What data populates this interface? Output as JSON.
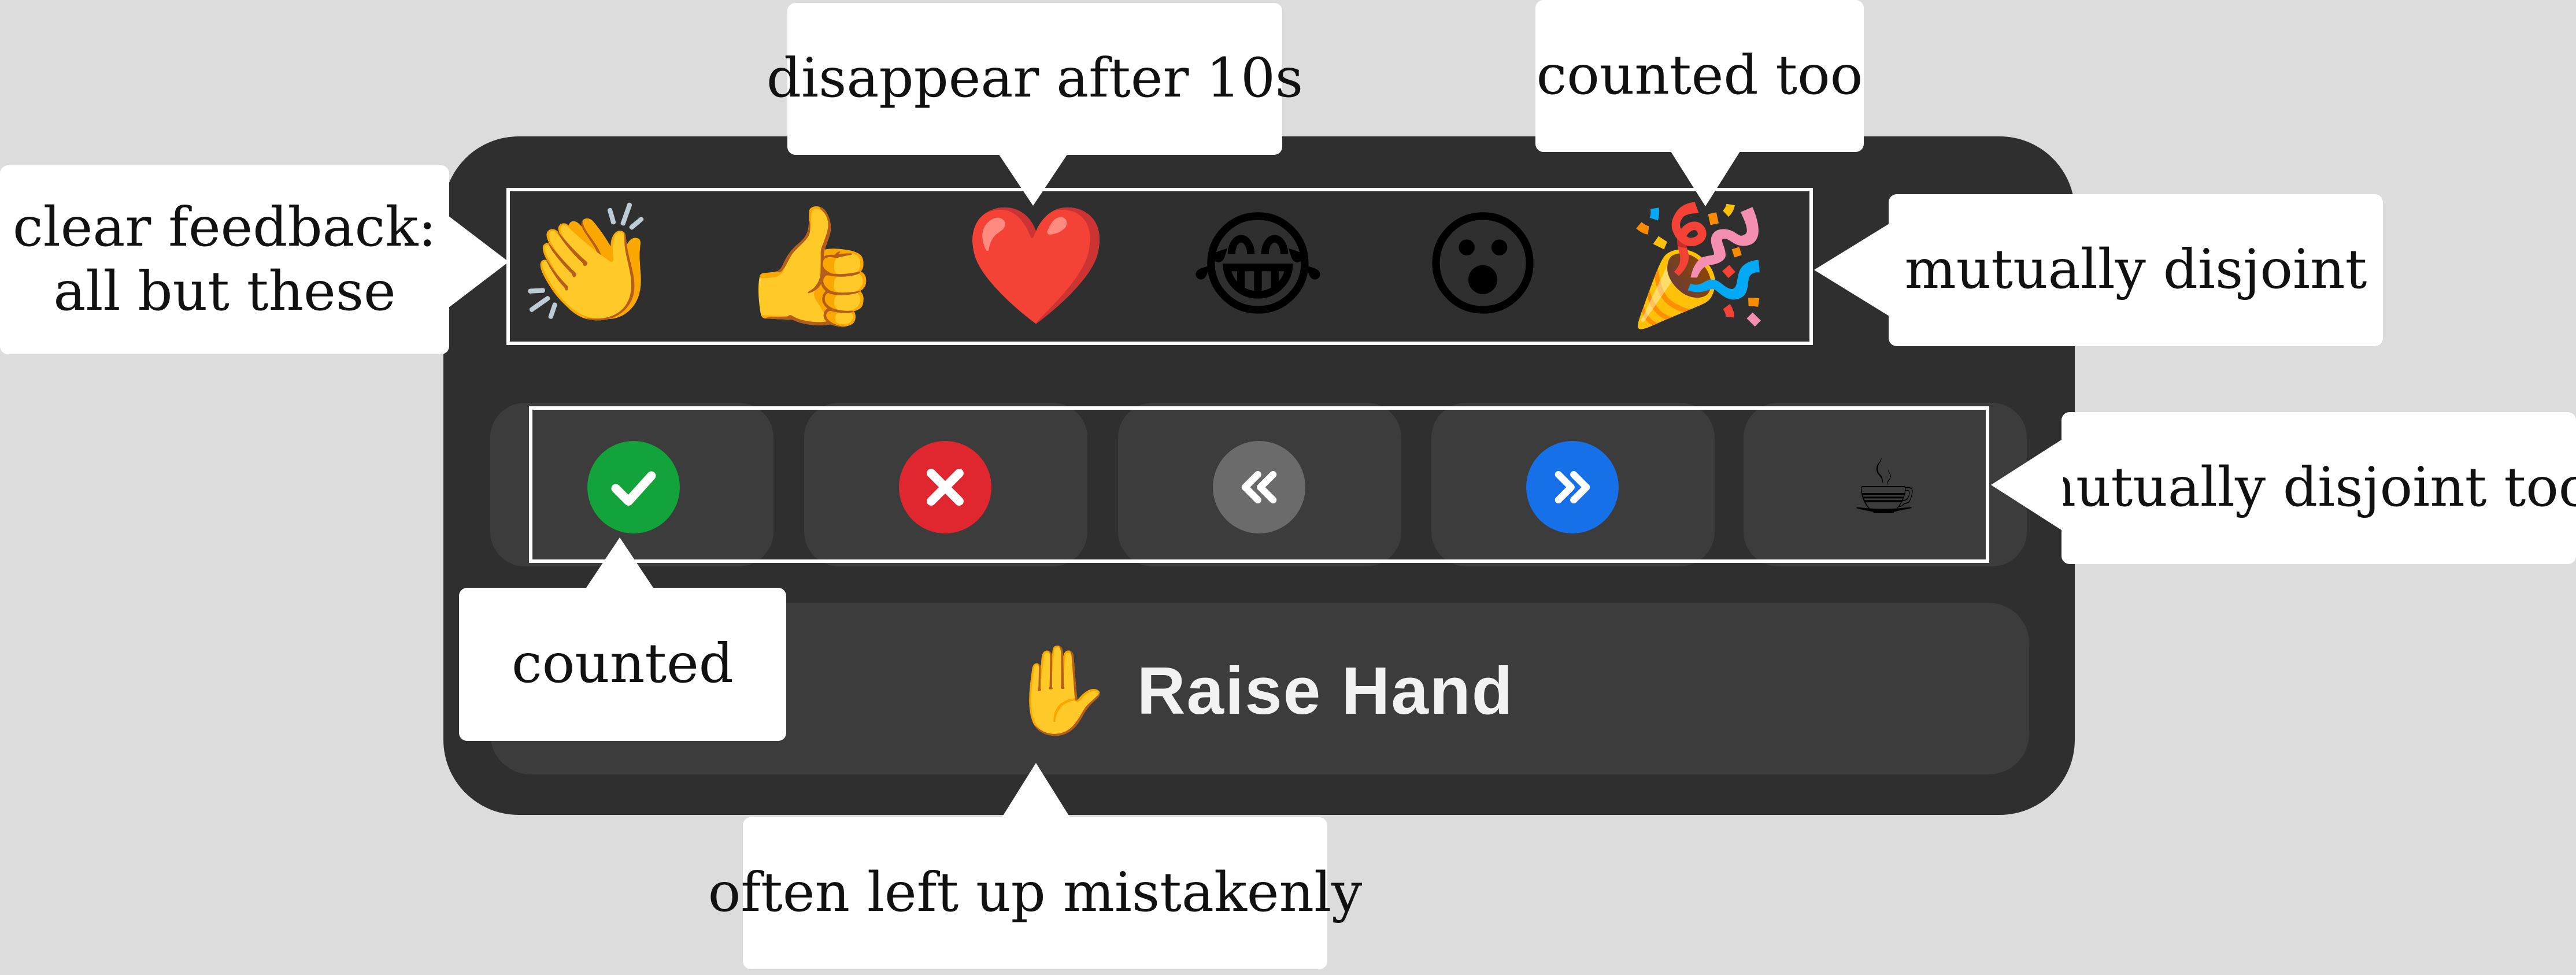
{
  "reactions": [
    {
      "name": "clapping-hands",
      "glyph": "👏"
    },
    {
      "name": "thumbs-up",
      "glyph": "👍"
    },
    {
      "name": "heart",
      "glyph": "❤️"
    },
    {
      "name": "tears-of-joy",
      "glyph": "😂"
    },
    {
      "name": "surprised-face",
      "glyph": "😮"
    },
    {
      "name": "party-popper",
      "glyph": "🎉"
    }
  ],
  "status_buttons": [
    {
      "name": "yes",
      "icon": "checkmark-icon",
      "color": "#12a33a"
    },
    {
      "name": "no",
      "icon": "x-icon",
      "color": "#e0262e"
    },
    {
      "name": "go-slower",
      "icon": "rewind-icon",
      "color": "#6b6b6b"
    },
    {
      "name": "go-faster",
      "icon": "fast-forward-icon",
      "color": "#1670e8"
    },
    {
      "name": "coffee-break",
      "glyph": "☕"
    }
  ],
  "raise_hand": {
    "glyph": "✋",
    "label": "Raise Hand"
  },
  "annotations": {
    "clear_feedback_line1": "clear feedback:",
    "clear_feedback_line2": "all but these",
    "disappear": "disappear after 10s",
    "counted_too": "counted too",
    "mutually_disjoint": "mutually disjoint",
    "mutually_disjoint_too": "mutually disjoint too!",
    "counted": "counted",
    "often_left_up": "often left up mistakenly"
  }
}
